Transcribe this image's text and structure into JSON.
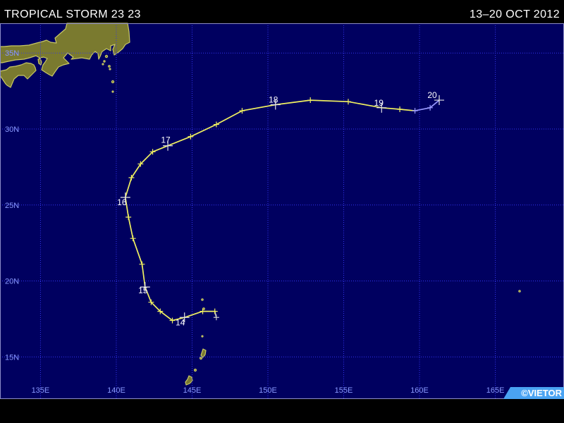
{
  "header": {
    "title": "TROPICAL STORM 23 23",
    "dates": "13–20 OCT 2012"
  },
  "credit": "©VIETOR",
  "map": {
    "extent": {
      "lon": [
        132.33,
        169.53
      ],
      "lat": [
        12.23,
        36.96
      ]
    },
    "lat_ticks": [
      {
        "value": 35,
        "label": "35N"
      },
      {
        "value": 30,
        "label": "30N"
      },
      {
        "value": 25,
        "label": "25N"
      },
      {
        "value": 20,
        "label": "20N"
      },
      {
        "value": 15,
        "label": "15N"
      }
    ],
    "lon_ticks": [
      {
        "value": 135,
        "label": "135E"
      },
      {
        "value": 140,
        "label": "140E"
      },
      {
        "value": 145,
        "label": "145E"
      },
      {
        "value": 150,
        "label": "150E"
      },
      {
        "value": 155,
        "label": "155E"
      },
      {
        "value": 160,
        "label": "160E"
      },
      {
        "value": 165,
        "label": "165E"
      }
    ],
    "colors": {
      "ocean": "#000060",
      "land": "#7a7a2f",
      "coast": "#c8c864",
      "grid": "#3434ee",
      "tick_label": "#8a9aff",
      "credit_box": "#4aa3f2"
    }
  },
  "track": {
    "day_marker_color": "#e2e2e2",
    "segments": [
      {
        "color": "#c8c8c8",
        "points": [
          {
            "lon": 146.6,
            "lat": 17.6
          },
          {
            "lon": 146.5,
            "lat": 18.0
          }
        ]
      },
      {
        "color": "#f0f060",
        "points": [
          {
            "lon": 146.5,
            "lat": 18.0
          },
          {
            "lon": 145.7,
            "lat": 18.0
          },
          {
            "lon": 144.5,
            "lat": 17.6,
            "day": "14"
          },
          {
            "lon": 143.7,
            "lat": 17.4
          },
          {
            "lon": 142.9,
            "lat": 18.0
          },
          {
            "lon": 142.3,
            "lat": 18.6
          },
          {
            "lon": 141.9,
            "lat": 19.6,
            "day": "15"
          },
          {
            "lon": 141.7,
            "lat": 21.1
          },
          {
            "lon": 141.1,
            "lat": 22.8
          },
          {
            "lon": 140.8,
            "lat": 24.2
          },
          {
            "lon": 140.6,
            "lat": 25.5,
            "day": "16"
          },
          {
            "lon": 141.0,
            "lat": 26.8
          },
          {
            "lon": 141.6,
            "lat": 27.7
          },
          {
            "lon": 142.4,
            "lat": 28.5
          },
          {
            "lon": 143.4,
            "lat": 28.9,
            "day": "17"
          },
          {
            "lon": 144.9,
            "lat": 29.5
          },
          {
            "lon": 146.6,
            "lat": 30.3
          },
          {
            "lon": 148.3,
            "lat": 31.2
          },
          {
            "lon": 150.5,
            "lat": 31.6,
            "day": "18"
          },
          {
            "lon": 152.8,
            "lat": 31.9
          },
          {
            "lon": 155.3,
            "lat": 31.8
          },
          {
            "lon": 157.5,
            "lat": 31.4,
            "day": "19"
          },
          {
            "lon": 158.7,
            "lat": 31.3
          },
          {
            "lon": 159.7,
            "lat": 31.2
          }
        ]
      },
      {
        "color": "#9a9aff",
        "points": [
          {
            "lon": 159.7,
            "lat": 31.2
          },
          {
            "lon": 160.7,
            "lat": 31.4
          },
          {
            "lon": 161.3,
            "lat": 31.9,
            "day": "20"
          }
        ]
      }
    ]
  }
}
